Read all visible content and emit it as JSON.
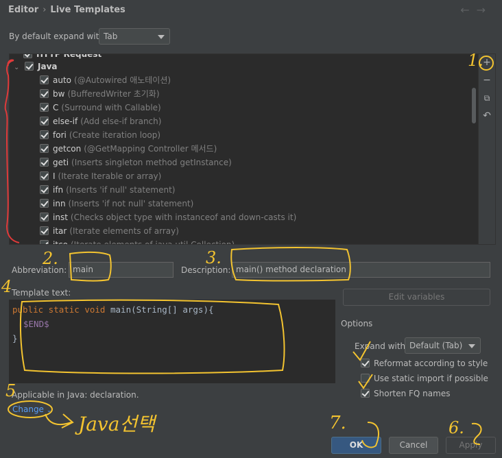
{
  "header": {
    "breadcrumb": [
      "Editor",
      "Live Templates"
    ],
    "back_arrow": "←",
    "forward_arrow": "→"
  },
  "expand": {
    "label": "By default expand with",
    "value": "Tab"
  },
  "tree": {
    "partial_top": "HTTP Request",
    "group": "Java",
    "items": [
      {
        "abbr": "auto",
        "desc": "(@Autowired 애노테이션)"
      },
      {
        "abbr": "bw",
        "desc": "(BufferedWriter 초기화)"
      },
      {
        "abbr": "C",
        "desc": "(Surround with Callable)"
      },
      {
        "abbr": "else-if",
        "desc": "(Add else-if branch)"
      },
      {
        "abbr": "fori",
        "desc": "(Create iteration loop)"
      },
      {
        "abbr": "getcon",
        "desc": "(@GetMapping Controller 메서드)"
      },
      {
        "abbr": "geti",
        "desc": "(Inserts singleton method getInstance)"
      },
      {
        "abbr": "I",
        "desc": "(Iterate Iterable or array)"
      },
      {
        "abbr": "ifn",
        "desc": "(Inserts 'if null' statement)"
      },
      {
        "abbr": "inn",
        "desc": "(Inserts 'if not null' statement)"
      },
      {
        "abbr": "inst",
        "desc": "(Checks object type with instanceof and down-casts it)"
      },
      {
        "abbr": "itar",
        "desc": "(Iterate elements of array)"
      },
      {
        "abbr": "itco",
        "desc": "(Iterate elements of java.util.Collection)"
      }
    ]
  },
  "toolbar": {
    "add": "+",
    "remove": "−",
    "copy": "⧉",
    "restore": "↶"
  },
  "abbreviation": {
    "label": "Abbreviation:",
    "value": "main"
  },
  "description": {
    "label": "Description:",
    "value": "main() method declaration"
  },
  "template": {
    "label": "Template text:",
    "line1_kw": "public static void",
    "line1_rest": " main(String[] args){",
    "line2": "$END$",
    "line3": "}"
  },
  "edit_variables": "Edit variables",
  "options": {
    "title": "Options",
    "expand_label": "Expand with",
    "expand_value": "Default (Tab)",
    "reformat": "Reformat according to style",
    "static_import": "Use static import if possible",
    "shorten": "Shorten FQ names"
  },
  "applicable": {
    "text": "Applicable in Java: declaration.",
    "change": "Change"
  },
  "buttons": {
    "ok": "OK",
    "cancel": "Cancel",
    "apply": "Apply"
  },
  "annotations": {
    "n1": "1.",
    "n2": "2.",
    "n3": "3.",
    "n4": "4",
    "n5": "5",
    "n6": "6.",
    "n7": "7.",
    "java_note": "Java선택"
  },
  "colors": {
    "background": "#3c3f41",
    "tree_bg": "#2b2b2b",
    "primary_button": "#365880",
    "link": "#589df6",
    "annotation_yellow": "#f4c430",
    "annotation_red": "#e03a3a"
  }
}
